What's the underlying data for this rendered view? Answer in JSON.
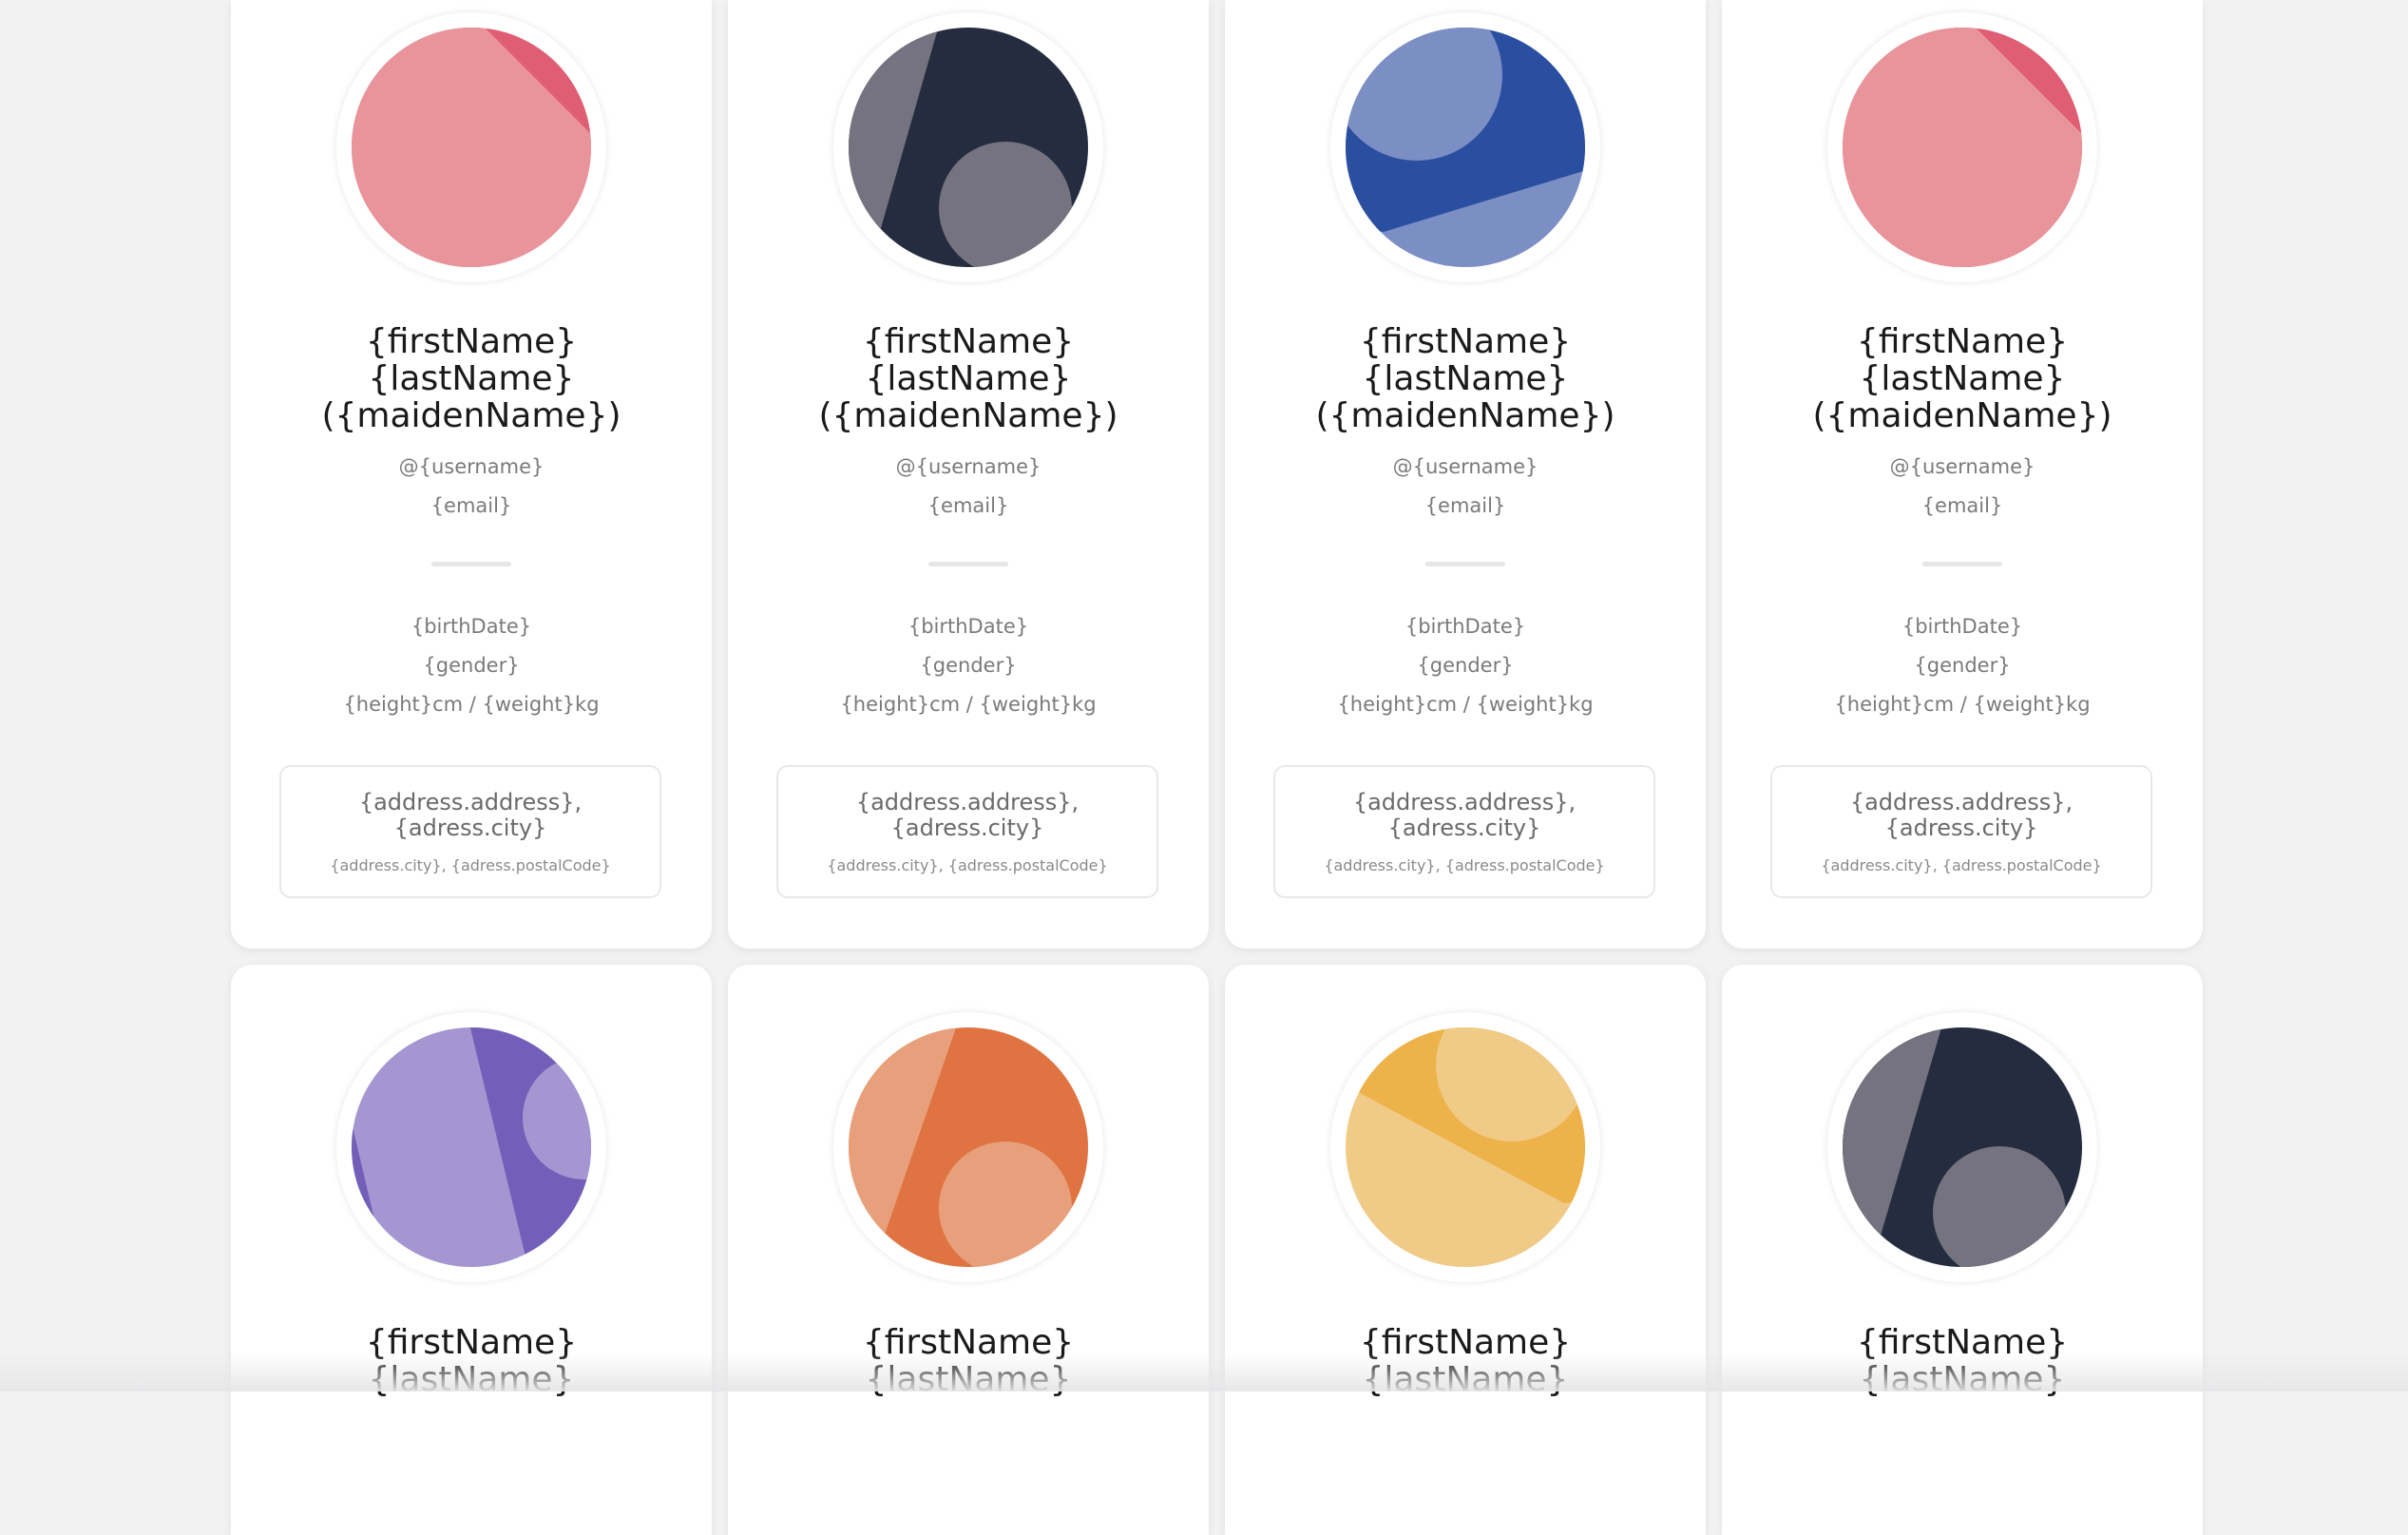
{
  "cards": [
    {
      "first_name": "{firstName}",
      "last_name": "{lastName}",
      "maiden_name": "({maidenName})",
      "username": "@{username}",
      "email": "{email}",
      "birth_date": "{birthDate}",
      "gender": "{gender}",
      "height_weight": "{height}cm / {weight}kg",
      "address_line1": "{address.address},",
      "address_line2": "{adress.city}",
      "address_sub": "{address.city}, {adress.postalCode}",
      "avatar_colors": {
        "light": "#e8949a",
        "dark": "#e05e73"
      }
    },
    {
      "first_name": "{firstName}",
      "last_name": "{lastName}",
      "maiden_name": "({maidenName})",
      "username": "@{username}",
      "email": "{email}",
      "birth_date": "{birthDate}",
      "gender": "{gender}",
      "height_weight": "{height}cm / {weight}kg",
      "address_line1": "{address.address},",
      "address_line2": "{adress.city}",
      "address_sub": "{address.city}, {adress.postalCode}",
      "avatar_colors": {
        "light": "#74737f",
        "dark": "#252c3f"
      }
    },
    {
      "first_name": "{firstName}",
      "last_name": "{lastName}",
      "maiden_name": "({maidenName})",
      "username": "@{username}",
      "email": "{email}",
      "birth_date": "{birthDate}",
      "gender": "{gender}",
      "height_weight": "{height}cm / {weight}kg",
      "address_line1": "{address.address},",
      "address_line2": "{adress.city}",
      "address_sub": "{address.city}, {adress.postalCode}",
      "avatar_colors": {
        "light": "#7c8fc4",
        "dark": "#2b4fa0"
      }
    },
    {
      "first_name": "{firstName}",
      "last_name": "{lastName}",
      "maiden_name": "({maidenName})",
      "username": "@{username}",
      "email": "{email}",
      "birth_date": "{birthDate}",
      "gender": "{gender}",
      "height_weight": "{height}cm / {weight}kg",
      "address_line1": "{address.address},",
      "address_line2": "{adress.city}",
      "address_sub": "{address.city}, {adress.postalCode}",
      "avatar_colors": {
        "light": "#e8949a",
        "dark": "#e05e73"
      }
    },
    {
      "first_name": "{firstName}",
      "last_name": "{lastName}",
      "avatar_colors": {
        "light": "#a596d1",
        "dark": "#735fb9"
      }
    },
    {
      "first_name": "{firstName}",
      "last_name": "{lastName}",
      "avatar_colors": {
        "light": "#e8a07c",
        "dark": "#e07342"
      }
    },
    {
      "first_name": "{firstName}",
      "last_name": "{lastName}",
      "avatar_colors": {
        "light": "#f0cb88",
        "dark": "#eeb24a"
      }
    },
    {
      "first_name": "{firstName}",
      "last_name": "{lastName}",
      "avatar_colors": {
        "light": "#74737f",
        "dark": "#252c3f"
      }
    }
  ]
}
